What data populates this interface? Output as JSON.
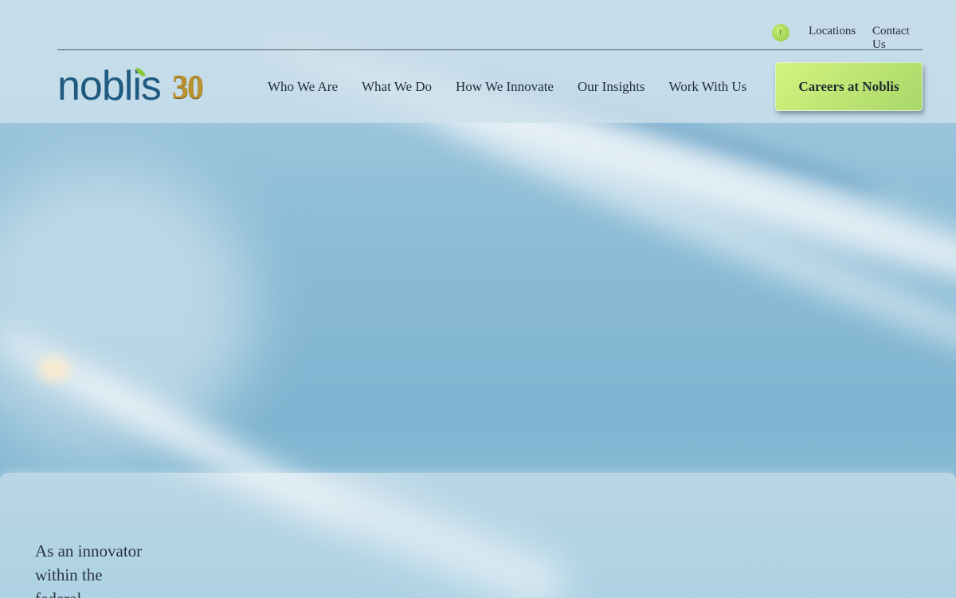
{
  "header": {
    "utility": {
      "search_icon_glyph": "r",
      "locations": "Locations",
      "contact": "Contact Us"
    },
    "logo": {
      "wordmark": "noblis",
      "anniversary": "30"
    },
    "nav": [
      {
        "label": "Who We Are"
      },
      {
        "label": "What We Do"
      },
      {
        "label": "How We Innovate"
      },
      {
        "label": "Our Insights"
      },
      {
        "label": "Work With Us"
      }
    ],
    "careers_button": "Careers at Noblis"
  },
  "content": {
    "intro": "As an innovator within the federal"
  },
  "colors": {
    "accent_green": "#a8d86a",
    "brand_blue": "#1f5a80",
    "gold": "#b8922e"
  },
  "icons": [
    "search-icon",
    "leaf-icon"
  ]
}
